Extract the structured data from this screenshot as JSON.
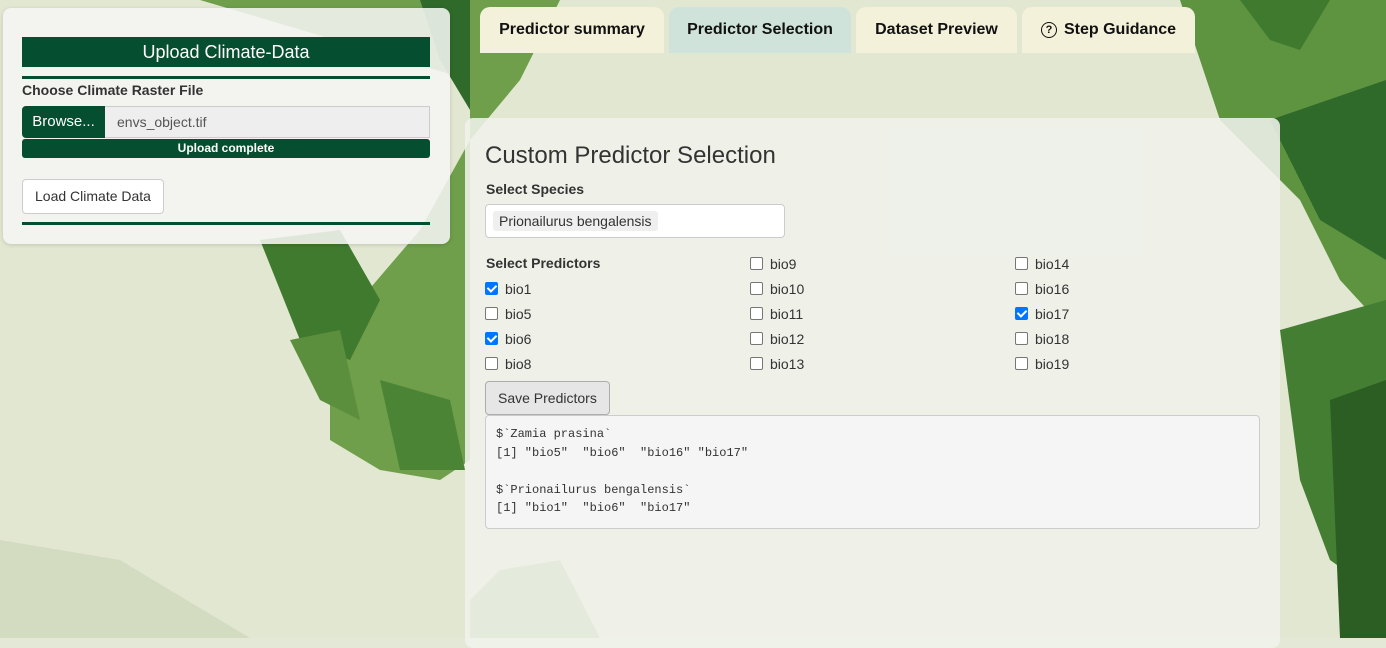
{
  "sidebar": {
    "header": "Upload Climate-Data",
    "file_label": "Choose Climate Raster File",
    "browse_label": "Browse...",
    "file_name": "envs_object.tif",
    "progress": 1.0,
    "progress_text": "Upload complete",
    "load_button": "Load Climate Data"
  },
  "tabs": [
    {
      "label": "Predictor summary",
      "active": false
    },
    {
      "label": "Predictor Selection",
      "active": true
    },
    {
      "label": "Dataset Preview",
      "active": false
    },
    {
      "label": "Step Guidance",
      "active": false,
      "icon": "question-circle-icon"
    }
  ],
  "main": {
    "title": "Custom Predictor Selection",
    "species_label": "Select Species",
    "species_selected": "Prionailurus bengalensis",
    "predictors_label": "Select Predictors",
    "predictors": [
      {
        "label": "bio1",
        "checked": true
      },
      {
        "label": "bio5",
        "checked": false
      },
      {
        "label": "bio6",
        "checked": true
      },
      {
        "label": "bio8",
        "checked": false
      },
      {
        "label": "bio9",
        "checked": false
      },
      {
        "label": "bio10",
        "checked": false
      },
      {
        "label": "bio11",
        "checked": false
      },
      {
        "label": "bio12",
        "checked": false
      },
      {
        "label": "bio13",
        "checked": false
      },
      {
        "label": "bio14",
        "checked": false
      },
      {
        "label": "bio16",
        "checked": false
      },
      {
        "label": "bio17",
        "checked": true
      },
      {
        "label": "bio18",
        "checked": false
      },
      {
        "label": "bio19",
        "checked": false
      }
    ],
    "save_button": "Save Predictors",
    "output_lines": [
      "$`Zamia prasina`",
      "[1] \"bio5\"  \"bio6\"  \"bio16\" \"bio17\"",
      "",
      "$`Prionailurus bengalensis`",
      "[1] \"bio1\"  \"bio6\"  \"bio17\""
    ]
  },
  "colors": {
    "brand_green": "#054e2f",
    "tab_bg": "#f3f1da",
    "tab_active_bg": "#cfe3da",
    "checkbox_accent": "#0075ff"
  }
}
